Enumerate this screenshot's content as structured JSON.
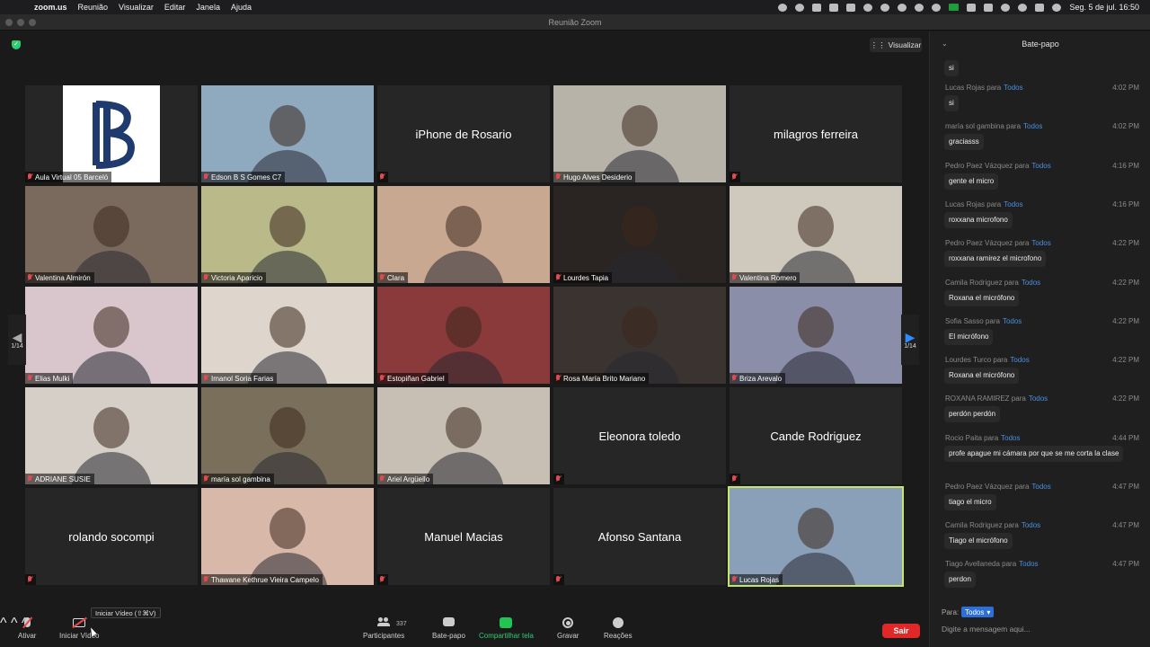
{
  "menubar": {
    "app": "zoom.us",
    "menus": [
      "Reunião",
      "Visualizar",
      "Editar",
      "Janela",
      "Ajuda"
    ],
    "clock": "Seg. 5 de jul.  16:50"
  },
  "window": {
    "title": "Reunião Zoom"
  },
  "view_button": "Visualizar",
  "tiles": [
    {
      "name": "Aula Virtual 05 Barceló",
      "kind": "logo"
    },
    {
      "name": "Edson B S Gomes C7",
      "kind": "photo",
      "bg": "#8fa9bf"
    },
    {
      "name": "",
      "kind": "text",
      "center": "iPhone de Rosario"
    },
    {
      "name": "Hugo Alves Desiderio",
      "kind": "photo",
      "bg": "#b8b3a8"
    },
    {
      "name": "",
      "kind": "text",
      "center": "milagros ferreira"
    },
    {
      "name": "Valentina Almirón",
      "kind": "photo",
      "bg": "#7a6a5e"
    },
    {
      "name": "Victoria Aparicio",
      "kind": "photo",
      "bg": "#b9b98a"
    },
    {
      "name": "Clara",
      "kind": "photo",
      "bg": "#c9a892"
    },
    {
      "name": "Lourdes Tapia",
      "kind": "photo",
      "bg": "#2a2522"
    },
    {
      "name": "Valentina Romero",
      "kind": "photo",
      "bg": "#cfc8bc"
    },
    {
      "name": "Elias Mulki",
      "kind": "photo",
      "bg": "#d8c6cc"
    },
    {
      "name": "Imanol Soria Farias",
      "kind": "photo",
      "bg": "#ded6cc"
    },
    {
      "name": "Estopiñan Gabriel",
      "kind": "photo",
      "bg": "#8a3a3a"
    },
    {
      "name": "Rosa María Brito Mariano",
      "kind": "photo",
      "bg": "#3a3330"
    },
    {
      "name": "Briza Arevalo",
      "kind": "photo",
      "bg": "#8a8ea8"
    },
    {
      "name": "ADRIANE SUSIE",
      "kind": "photo",
      "bg": "#d6cfc8"
    },
    {
      "name": "maría sol gambina",
      "kind": "photo",
      "bg": "#7a6f5a"
    },
    {
      "name": "Ariel Argüello",
      "kind": "photo",
      "bg": "#c7bfb3"
    },
    {
      "name": "",
      "kind": "text",
      "center": "Eleonora toledo"
    },
    {
      "name": "",
      "kind": "text",
      "center": "Cande Rodriguez"
    },
    {
      "name": "",
      "kind": "text",
      "center": "rolando socompi"
    },
    {
      "name": "Thawane Kethrue Vieira Campelo",
      "kind": "photo",
      "bg": "#d8b8a8"
    },
    {
      "name": "",
      "kind": "text",
      "center": "Manuel Macias"
    },
    {
      "name": "",
      "kind": "text",
      "center": "Afonso Santana"
    },
    {
      "name": "Lucas Rojas",
      "kind": "photo",
      "bg": "#8aa0b8",
      "active": true
    }
  ],
  "pager": {
    "left": "1/14",
    "right": "1/14"
  },
  "toolbar": {
    "mute": "Ativar",
    "video": "Iniciar Vídeo",
    "participants": "Participantes",
    "participant_count": "337",
    "chat": "Bate-papo",
    "share": "Compartilhar tela",
    "record": "Gravar",
    "reactions": "Reações",
    "leave": "Sair",
    "tooltip": "Iniciar Vídeo (⇧⌘V)"
  },
  "chat": {
    "title": "Bate-papo",
    "first_text": "si",
    "messages": [
      {
        "sender": "Lucas Rojas",
        "to": "Todos",
        "time": "4:02 PM",
        "text": "si"
      },
      {
        "sender": "maría sol gambina",
        "to": "Todos",
        "time": "4:02 PM",
        "text": "graciasss"
      },
      {
        "sender": "Pedro Paez Vázquez",
        "to": "Todos",
        "time": "4:16 PM",
        "text": "gente el micro"
      },
      {
        "sender": "Lucas Rojas",
        "to": "Todos",
        "time": "4:16 PM",
        "text": "roxxana microfono"
      },
      {
        "sender": "Pedro Paez Vázquez",
        "to": "Todos",
        "time": "4:22 PM",
        "text": "roxxana ramirez el microfono"
      },
      {
        "sender": "Camila Rodriguez",
        "to": "Todos",
        "time": "4:22 PM",
        "text": "Roxana el micrófono"
      },
      {
        "sender": "Sofia Sasso",
        "to": "Todos",
        "time": "4:22 PM",
        "text": "El micrófono"
      },
      {
        "sender": "Lourdes Turco",
        "to": "Todos",
        "time": "4:22 PM",
        "text": "Roxana el micrófono"
      },
      {
        "sender": "ROXANA RAMIREZ",
        "to": "Todos",
        "time": "4:22 PM",
        "text": "perdón perdón"
      },
      {
        "sender": "Rocio Paita",
        "to": "Todos",
        "time": "4:44 PM",
        "text": "profe apague mi cámara por que se me corta la clase"
      },
      {
        "sender": "Pedro Paez Vázquez",
        "to": "Todos",
        "time": "4:47 PM",
        "text": "tiago el micro"
      },
      {
        "sender": "Camila Rodriguez",
        "to": "Todos",
        "time": "4:47 PM",
        "text": "Tiago el micrófono"
      },
      {
        "sender": "Tiago Avellaneda",
        "to": "Todos",
        "time": "4:47 PM",
        "text": "perdon"
      }
    ],
    "para_label": "Para:",
    "para_value": "Todos",
    "placeholder": "Digite a mensagem aqui..."
  }
}
